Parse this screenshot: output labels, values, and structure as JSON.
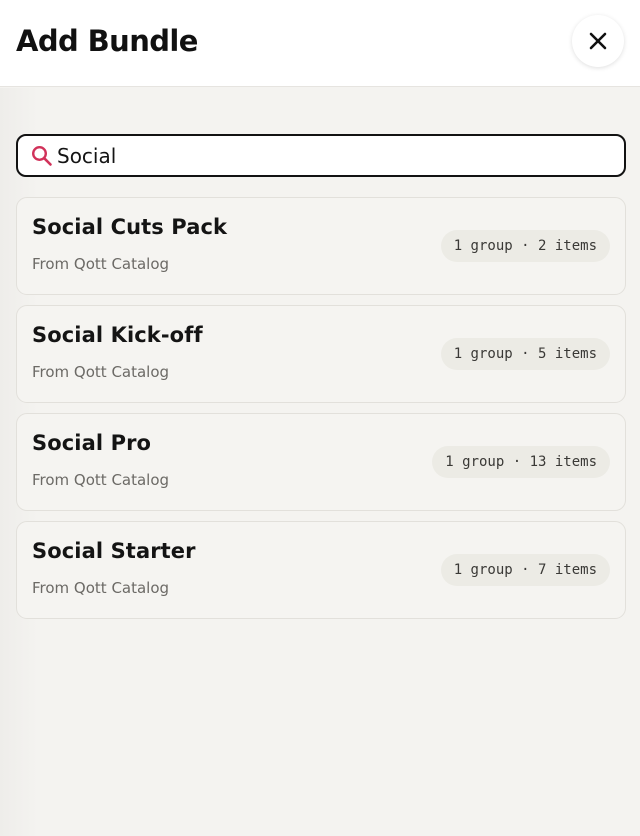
{
  "header": {
    "title": "Add Bundle",
    "close_icon": "close-icon"
  },
  "search": {
    "value": "Social",
    "icon": "search-icon",
    "icon_color": "#d1325a"
  },
  "results": [
    {
      "title": "Social Cuts Pack",
      "source": "From Qott Catalog",
      "badge": "1 group · 2 items"
    },
    {
      "title": "Social Kick-off",
      "source": "From Qott Catalog",
      "badge": "1 group · 5 items"
    },
    {
      "title": "Social Pro",
      "source": "From Qott Catalog",
      "badge": "1 group · 13 items"
    },
    {
      "title": "Social Starter",
      "source": "From Qott Catalog",
      "badge": "1 group · 7 items"
    }
  ],
  "colors": {
    "background": "#f4f3f0",
    "header_background": "#ffffff",
    "accent": "#d1325a",
    "text": "#141414",
    "muted_text": "#6c6a66",
    "badge_background": "#ecebe5"
  }
}
